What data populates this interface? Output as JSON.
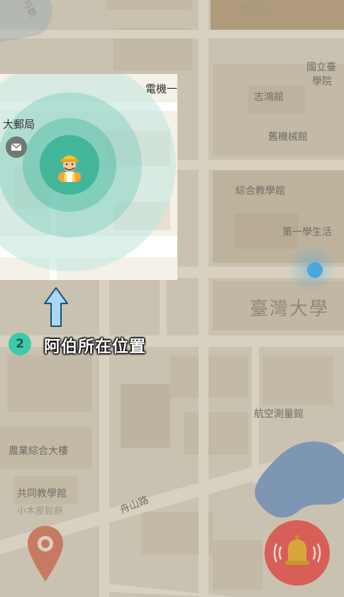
{
  "map": {
    "labels": {
      "top_left_road": "丹斷",
      "top_center": "電機一館",
      "top_right": "女九舍",
      "national_college": "國立臺",
      "national_college_2": "學院",
      "zhihong": "志鴻館",
      "mechanical": "舊機械館",
      "comprehensive": "綜合教學館",
      "first_student": "第一學生活",
      "ntu": "臺灣大學",
      "aero": "航空測量館",
      "agri": "農業綜合大樓",
      "common": "共同教學館",
      "cake": "小木屋鬆餅",
      "road": "舟山路",
      "post_office": "大郵局"
    },
    "colors": {
      "base": "#d8d1bf",
      "road": "#e9e3d2",
      "water": "#7a9cc4",
      "highlight_bg": "#f4f1e8",
      "radar_outer": "#bfe6dd",
      "radar_mid": "#8fd2c2",
      "radar_inner": "#5fbfa9"
    }
  },
  "overlay": {
    "step_number": "2",
    "step_text": "阿伯所在位置",
    "worker_icon": "construction-worker-icon",
    "mail_icon": "mail-icon",
    "arrow_icon": "up-arrow-icon"
  },
  "buttons": {
    "location_icon": "location-pin-icon",
    "alert_icon": "bell-alert-icon",
    "alert_color": "#d9534f"
  }
}
